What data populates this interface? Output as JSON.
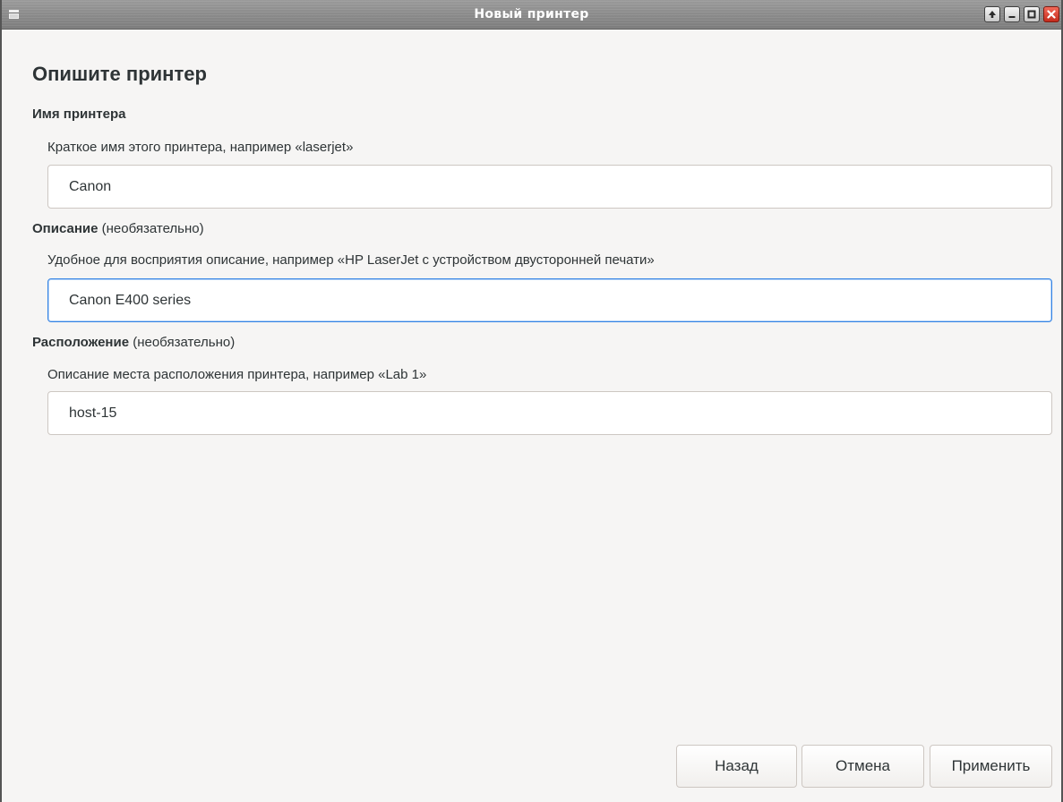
{
  "window": {
    "title": "Новый принтер"
  },
  "page": {
    "heading": "Опишите принтер"
  },
  "name_section": {
    "label": "Имя принтера",
    "hint": "Краткое имя этого принтера, например «laserjet»",
    "value": "Canon"
  },
  "description_section": {
    "label": "Описание",
    "optional": "(необязательно)",
    "hint": "Удобное для восприятия описание, например «HP LaserJet с устройством двусторонней печати»",
    "value": "Canon E400 series"
  },
  "location_section": {
    "label": "Расположение",
    "optional": "(необязательно)",
    "hint": "Описание места расположения принтера, например «Lab 1»",
    "value": "host-15"
  },
  "buttons": {
    "back": "Назад",
    "cancel": "Отмена",
    "apply": "Применить"
  },
  "colors": {
    "focus_border": "#3584e4",
    "close_button": "#c42b1c",
    "text": "#2e3436"
  },
  "icons": {
    "window_menu": "window-menu-icon",
    "raise": "arrow-up-icon",
    "minimize": "minimize-icon",
    "maximize": "maximize-icon",
    "close": "close-icon"
  }
}
